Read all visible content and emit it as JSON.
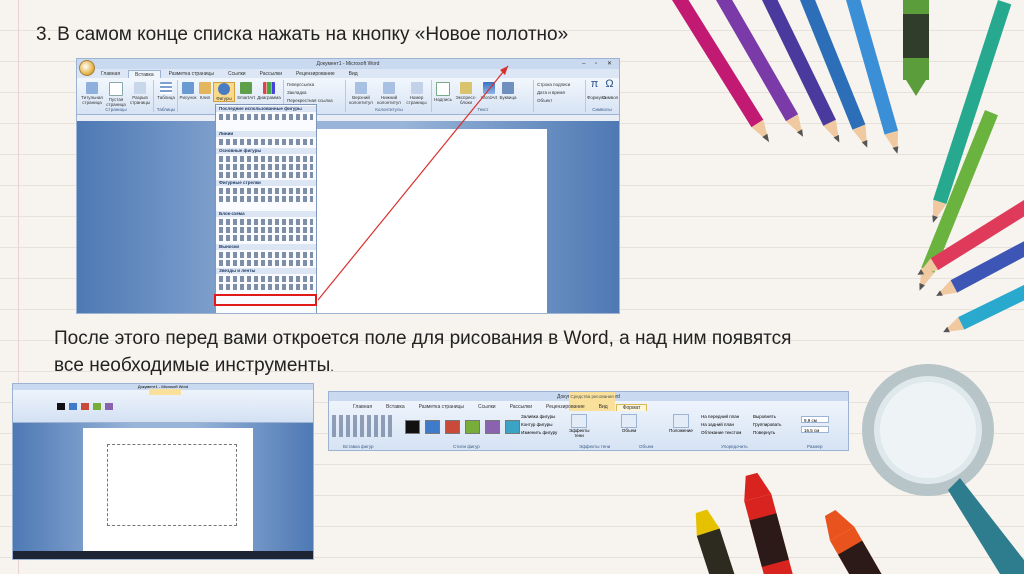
{
  "step_title": "3. В самом конце списка нажать на кнопку «Новое полотно»",
  "description": "После этого перед вами откроется поле для рисования в Word, а над ним появятся все необходимые инструменты",
  "description_end": ".",
  "word_main": {
    "window_title": "Документ1 - Microsoft Word",
    "tabs": [
      "Главная",
      "Вставка",
      "Разметка страницы",
      "Ссылки",
      "Рассылки",
      "Рецензирование",
      "Вид"
    ],
    "active_tab": "Вставка",
    "ribbon_buttons": {
      "title_page": "Титульная страница",
      "blank_page": "Пустая страница",
      "page_break": "Разрыв страницы",
      "table": "Таблица",
      "picture": "Рисунок",
      "clip": "Клип",
      "shapes": "Фигуры",
      "smartart": "SmartArt",
      "chart": "Диаграмма",
      "hyperlink": "Гиперссылка",
      "bookmark": "Закладка",
      "cross_ref": "Перекрестная ссылка",
      "header": "Верхний колонтитул",
      "footer": "Нижний колонтитул",
      "page_number": "Номер страницы",
      "textbox": "Надпись",
      "quick_parts": "Экспресс-блоки",
      "wordart": "WordArt",
      "dropcap": "Буквица",
      "signature_line": "Строка подписи",
      "date_time": "Дата и время",
      "object": "Объект",
      "equation": "Формула",
      "symbol": "Символ"
    },
    "ribbon_groups": {
      "pages": "Страницы",
      "tables": "Таблицы",
      "headers": "Колонтитулы",
      "text": "Текст",
      "symbols": "Символы"
    },
    "shapes_menu": {
      "recent": "Последние использованные фигуры",
      "lines": "Линии",
      "basic": "Основные фигуры",
      "arrows": "Фигурные стрелки",
      "flowchart": "Блок-схема",
      "callouts": "Выноски",
      "stars": "Звезды и ленты"
    }
  },
  "word_small": {
    "window_title": "Документ1 - Microsoft Word",
    "context_tab": "Средства рисования"
  },
  "ribbon_strip": {
    "window_title": "Документ1 - Microsoft Word",
    "context_tab": "Средства рисования",
    "tabs": [
      "Главная",
      "Вставка",
      "Разметка страницы",
      "Ссылки",
      "Рассылки",
      "Рецензирование",
      "Вид",
      "Формат"
    ],
    "active_tab": "Формат",
    "buttons": {
      "shape_fill": "Заливка фигуры",
      "shape_outline": "Контур фигуры",
      "change_shape": "Изменить фигуру",
      "shadow_effects": "Эффекты тени",
      "volume": "Объем",
      "position": "Положение",
      "bring_front": "На передний план",
      "send_back": "На задний план",
      "text_wrap": "Обтекание текстом",
      "align": "Выровнять",
      "group": "Группировать",
      "rotate": "Повернуть",
      "height": "9,9 см",
      "width": "16,5 см"
    },
    "groups": {
      "insert_shapes": "Вставка фигур",
      "shape_styles": "Стили фигур",
      "shadow": "Эффекты тени",
      "volume": "Объем",
      "arrange": "Упорядочить",
      "size": "Размер"
    },
    "swatch_colors": [
      "#111111",
      "#3f7bc8",
      "#c94a3a",
      "#78ad3a",
      "#8a63ae",
      "#3ba3c4"
    ]
  },
  "colors": {
    "highlight": "#e01a1a",
    "arrow": "#d9302b"
  }
}
